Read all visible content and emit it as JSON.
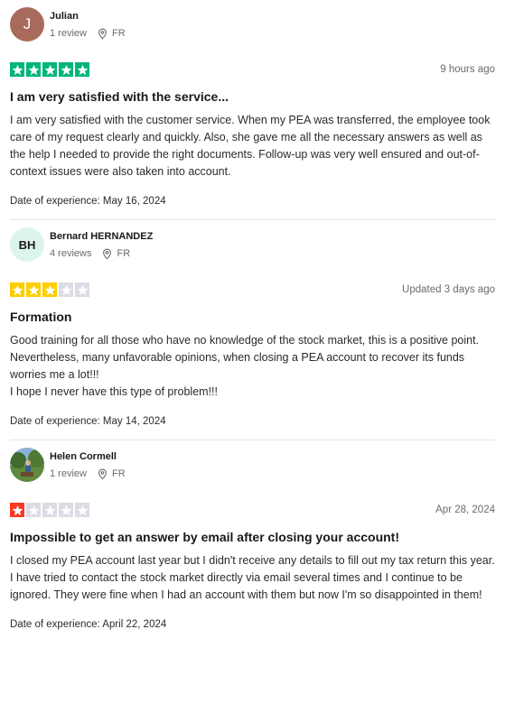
{
  "reviews": [
    {
      "avatar": {
        "type": "letter",
        "text": "J"
      },
      "name": "Julian",
      "review_count": "1 review",
      "country": "FR",
      "stars": 5,
      "star_color": "#00b67a",
      "date": "9 hours ago",
      "title": "I am very satisfied with the service...",
      "body": "I am very satisfied with the customer service. When my PEA was transferred, the employee took care of my request clearly and quickly. Also, she gave me all the necessary answers as well as the help I needed to provide the right documents. Follow-up was very well ensured and out-of-context issues were also taken into account.",
      "experience": "Date of experience: May 16, 2024"
    },
    {
      "avatar": {
        "type": "initials",
        "text": "BH"
      },
      "name": "Bernard HERNANDEZ",
      "review_count": "4 reviews",
      "country": "FR",
      "stars": 3,
      "star_color": "#ffce00",
      "date": "Updated 3 days ago",
      "title": "Formation",
      "body": "Good training for all those who have no knowledge of the stock market, this is a positive point. Nevertheless, many unfavorable opinions, when closing a PEA account to recover its funds worries me a lot!!!\nI hope I never have this type of problem!!!",
      "experience": "Date of experience: May 14, 2024"
    },
    {
      "avatar": {
        "type": "photo",
        "text": ""
      },
      "name": "Helen Cormell",
      "review_count": "1 review",
      "country": "FR",
      "stars": 1,
      "star_color": "#ff3722",
      "date": "Apr 28, 2024",
      "title": "Impossible to get an answer by email after closing your account!",
      "body": "I closed my PEA account last year but I didn't receive any details to fill out my tax return this year. I have tried to contact the stock market directly via email several times and I continue to be ignored. They were fine when I had an account with them but now I'm so disappointed in them!",
      "experience": "Date of experience: April 22, 2024"
    }
  ],
  "empty_star_color": "#dcdce6",
  "icons": {
    "location": "location-pin-icon",
    "star": "star-icon"
  }
}
